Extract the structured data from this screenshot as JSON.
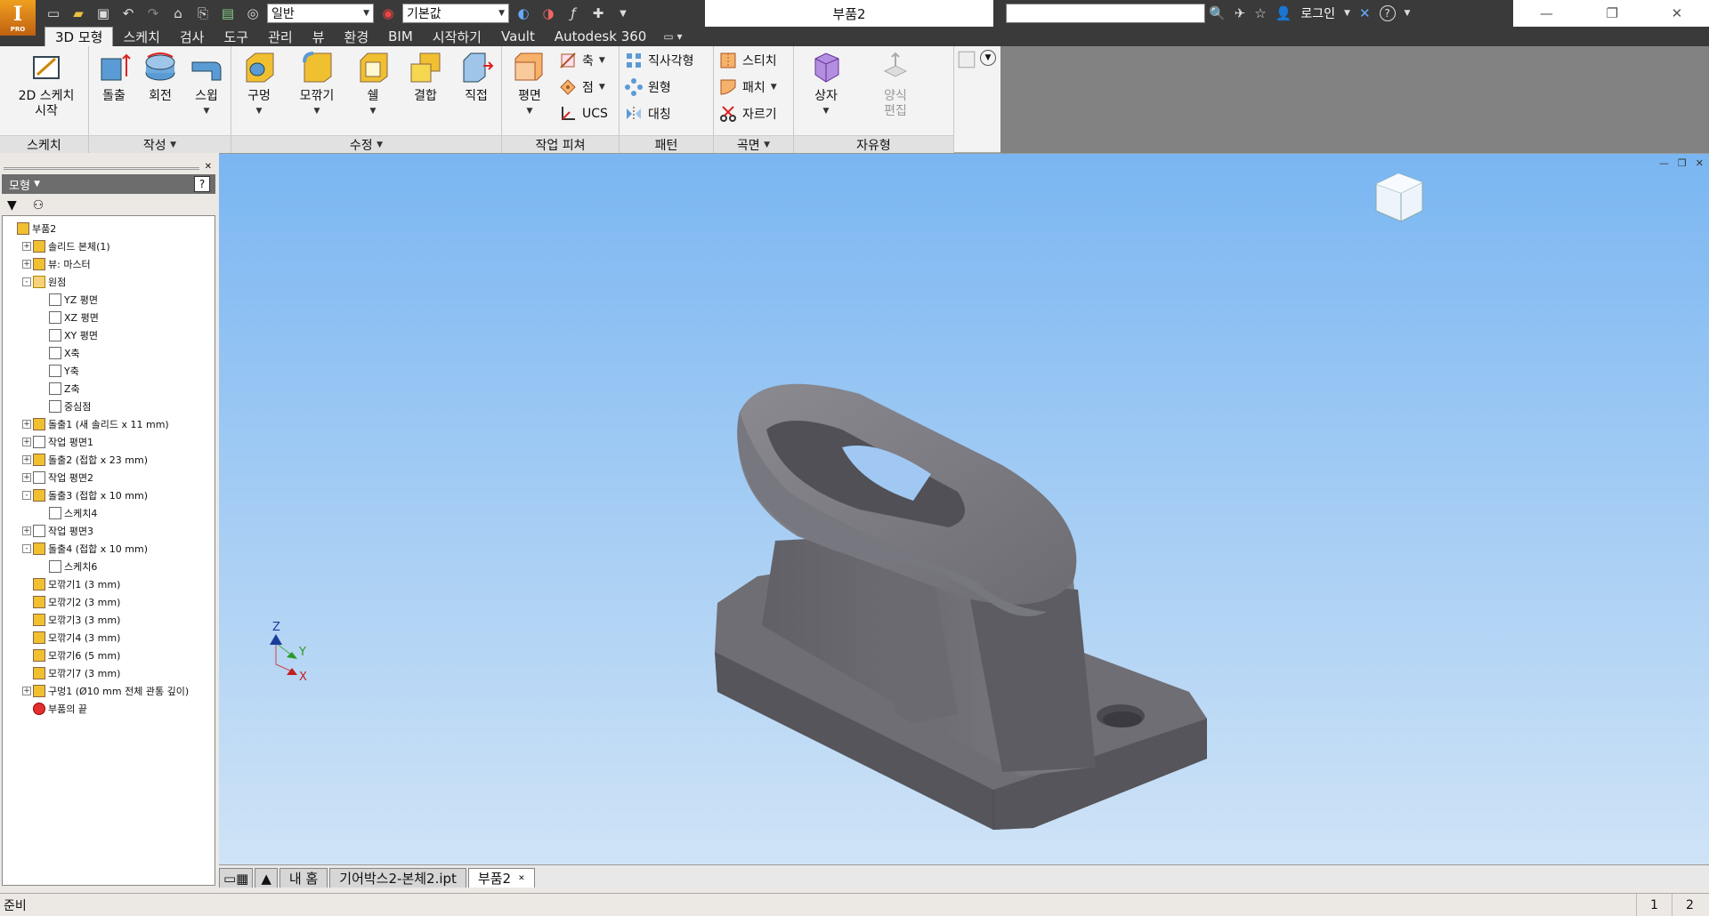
{
  "app": {
    "logo_letter": "I",
    "logo_sub": "PRO"
  },
  "qat": {
    "style_combo": "일반",
    "material_combo": "기본값",
    "doc_title": "부품2",
    "login_label": "로그인",
    "help_label": "?"
  },
  "tabs": [
    "3D 모형",
    "스케치",
    "검사",
    "도구",
    "관리",
    "뷰",
    "환경",
    "BIM",
    "시작하기",
    "Vault",
    "Autodesk 360"
  ],
  "ribbon": {
    "sketch": {
      "title": "스케치",
      "start_label": "2D 스케치\n시작"
    },
    "create": {
      "title": "작성",
      "extrude": "돌출",
      "revolve": "회전",
      "sweep": "스윕"
    },
    "modify": {
      "title": "수정",
      "hole": "구멍",
      "fillet": "모깎기",
      "shell": "쉘",
      "combine": "결합",
      "direct": "직접"
    },
    "work": {
      "title": "작업 피쳐",
      "plane": "평면",
      "axis": "축",
      "point": "점",
      "ucs": "UCS"
    },
    "pattern": {
      "title": "패턴",
      "rect": "직사각형",
      "circ": "원형",
      "mirror": "대칭"
    },
    "surface": {
      "title": "곡면",
      "stitch": "스티치",
      "patch": "패치",
      "trim": "자르기"
    },
    "freeform": {
      "title": "자유형",
      "box": "상자",
      "edit_form": "양식\n편집"
    }
  },
  "browser": {
    "title": "모형",
    "tree": [
      {
        "label": "부품2",
        "level": 0,
        "exp": ""
      },
      {
        "label": "솔리드 본체(1)",
        "level": 1,
        "exp": "+"
      },
      {
        "label": "뷰: 마스터",
        "level": 1,
        "exp": "+"
      },
      {
        "label": "원점",
        "level": 1,
        "exp": "-"
      },
      {
        "label": "YZ 평면",
        "level": 2,
        "exp": ""
      },
      {
        "label": "XZ 평면",
        "level": 2,
        "exp": ""
      },
      {
        "label": "XY 평면",
        "level": 2,
        "exp": ""
      },
      {
        "label": "X축",
        "level": 2,
        "exp": ""
      },
      {
        "label": "Y축",
        "level": 2,
        "exp": ""
      },
      {
        "label": "Z축",
        "level": 2,
        "exp": ""
      },
      {
        "label": "중심점",
        "level": 2,
        "exp": ""
      },
      {
        "label": "돌출1 (새 솔리드 x 11 mm)",
        "level": 1,
        "exp": "+"
      },
      {
        "label": "작업 평면1",
        "level": 1,
        "exp": "+"
      },
      {
        "label": "돌출2 (접합 x 23 mm)",
        "level": 1,
        "exp": "+"
      },
      {
        "label": "작업 평면2",
        "level": 1,
        "exp": "+"
      },
      {
        "label": "돌출3 (접합 x 10 mm)",
        "level": 1,
        "exp": "-"
      },
      {
        "label": "스케치4",
        "level": 2,
        "exp": ""
      },
      {
        "label": "작업 평면3",
        "level": 1,
        "exp": "+"
      },
      {
        "label": "돌출4 (접합 x 10 mm)",
        "level": 1,
        "exp": "-"
      },
      {
        "label": "스케치6",
        "level": 2,
        "exp": ""
      },
      {
        "label": "모깎기1 (3 mm)",
        "level": 1,
        "exp": ""
      },
      {
        "label": "모깎기2 (3 mm)",
        "level": 1,
        "exp": ""
      },
      {
        "label": "모깎기3 (3 mm)",
        "level": 1,
        "exp": ""
      },
      {
        "label": "모깎기4 (3 mm)",
        "level": 1,
        "exp": ""
      },
      {
        "label": "모깎기6 (5 mm)",
        "level": 1,
        "exp": ""
      },
      {
        "label": "모깎기7 (3 mm)",
        "level": 1,
        "exp": ""
      },
      {
        "label": "구멍1 (Ø10 mm 전체 관통 깊이)",
        "level": 1,
        "exp": "+"
      },
      {
        "label": "부품의 끝",
        "level": 1,
        "exp": ""
      }
    ]
  },
  "triad": {
    "x": "X",
    "y": "Y",
    "z": "Z"
  },
  "doctabs": {
    "home": "내 홈",
    "file1": "기어박스2-본체2.ipt",
    "file2": "부품2"
  },
  "status": {
    "text": "준비",
    "n1": "1",
    "n2": "2"
  }
}
